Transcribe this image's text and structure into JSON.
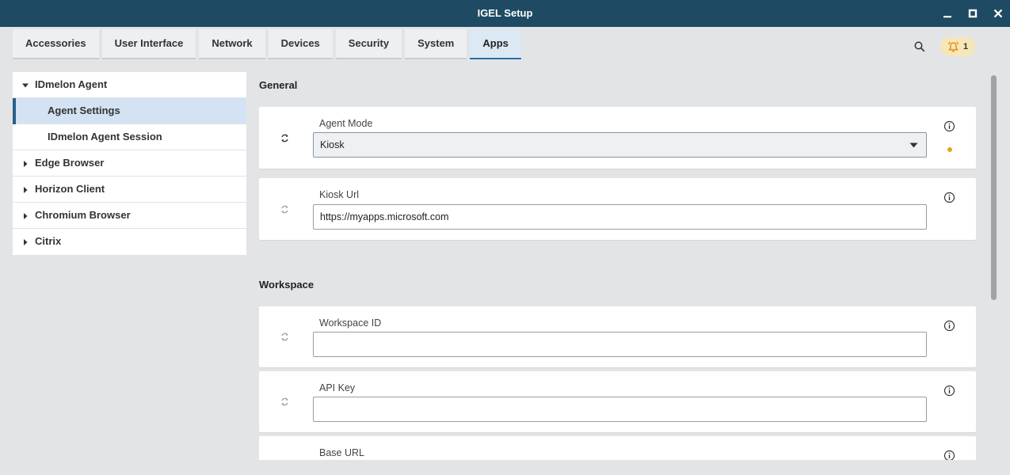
{
  "window": {
    "title": "IGEL Setup"
  },
  "tabs": [
    {
      "label": "Accessories"
    },
    {
      "label": "User Interface"
    },
    {
      "label": "Network"
    },
    {
      "label": "Devices"
    },
    {
      "label": "Security"
    },
    {
      "label": "System"
    },
    {
      "label": "Apps",
      "active": true
    }
  ],
  "notifications": {
    "count": "1"
  },
  "tree": {
    "items": [
      {
        "label": "IDmelon Agent",
        "expanded": true
      },
      {
        "label": "Agent Settings",
        "selected": true
      },
      {
        "label": "IDmelon Agent Session"
      },
      {
        "label": "Edge Browser"
      },
      {
        "label": "Horizon Client"
      },
      {
        "label": "Chromium Browser"
      },
      {
        "label": "Citrix"
      }
    ]
  },
  "sections": {
    "general": {
      "title": "General",
      "agent_mode": {
        "label": "Agent Mode",
        "value": "Kiosk"
      },
      "kiosk_url": {
        "label": "Kiosk Url",
        "value": "https://myapps.microsoft.com"
      }
    },
    "workspace": {
      "title": "Workspace",
      "workspace_id": {
        "label": "Workspace ID",
        "value": ""
      },
      "api_key": {
        "label": "API Key",
        "value": ""
      },
      "base_url": {
        "label": "Base URL"
      }
    }
  },
  "colors": {
    "titlebar": "#1e4a63",
    "accent": "#2b6ea8",
    "modified_dot": "#e9a21f",
    "notification_badge": "#f6e6b8"
  }
}
